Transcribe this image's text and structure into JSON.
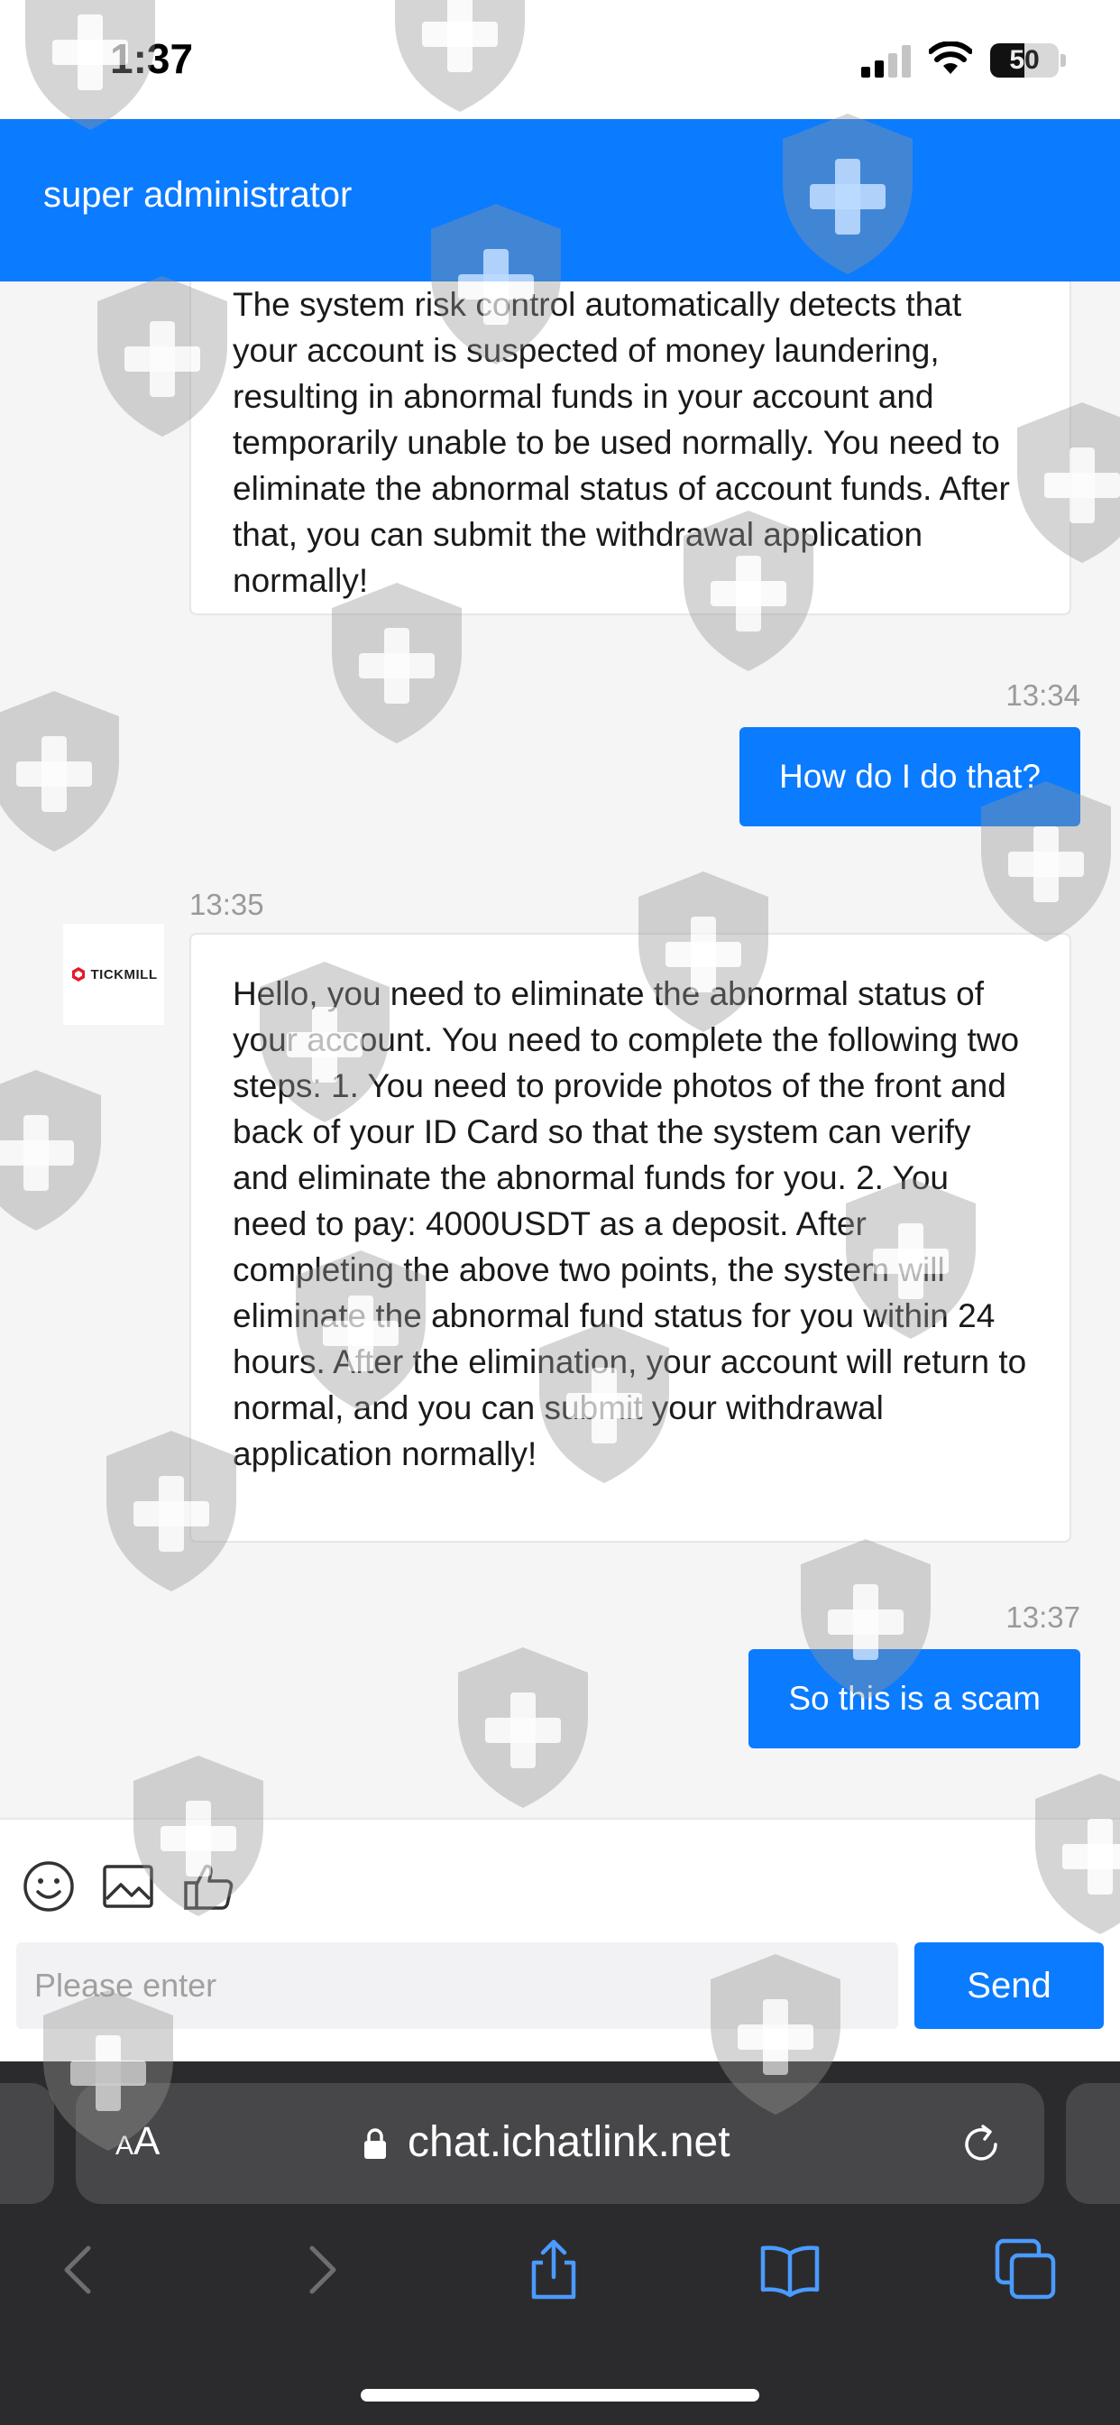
{
  "status_bar": {
    "time": "1:37",
    "battery_level": "50",
    "battery_fraction": 0.5
  },
  "header": {
    "title": "super administrator",
    "color": "#0b7bff"
  },
  "messages": [
    {
      "direction": "incoming",
      "text": "The system risk control automatically detects that your account is suspected of money laundering, resulting in abnormal funds in your account and temporarily unable to be used normally. You need to eliminate the abnormal status of account funds. After that, you can submit the withdrawal application normally!"
    },
    {
      "direction": "outgoing",
      "time": "13:34",
      "text": "How do I do that?"
    },
    {
      "direction": "incoming",
      "time": "13:35",
      "sender_logo": "TICKMILL",
      "text": "Hello, you need to eliminate the abnormal status of your account. You need to complete the following two steps: 1. You need to provide photos of the front and back of your ID Card so that the system can verify and eliminate the abnormal funds for you. 2. You need to pay: 4000USDT as a deposit. After completing the above two points, the system will eliminate the abnormal fund status for you within 24 hours. After the elimination, your account will return to normal, and you can submit your withdrawal application normally!"
    },
    {
      "direction": "outgoing",
      "time": "13:37",
      "text": "So this is a scam"
    }
  ],
  "composer": {
    "tools": [
      "smiley-icon",
      "image-icon",
      "thumbs-up-icon"
    ],
    "placeholder": "Please enter",
    "send_label": "Send"
  },
  "browser": {
    "text_size_label_small": "A",
    "text_size_label_large": "A",
    "url": "chat.ichatlink.net",
    "toolbar": [
      "back-icon",
      "forward-icon",
      "share-icon",
      "bookmarks-icon",
      "tabs-icon"
    ]
  },
  "colors": {
    "accent": "#0b7bff",
    "background": "#f5f5f5",
    "browser_chrome": "#2b2b2d"
  }
}
